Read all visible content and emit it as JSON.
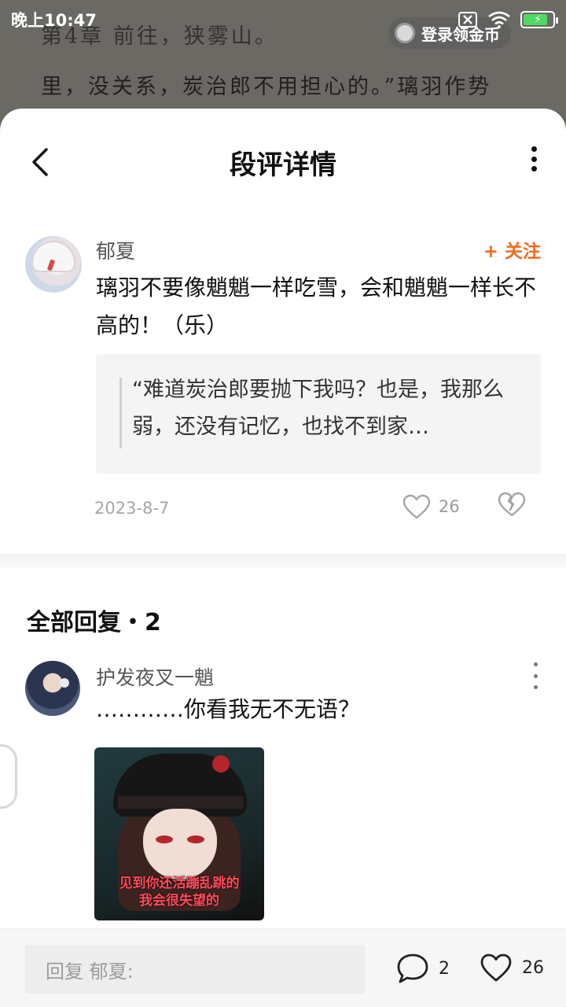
{
  "status_bar": {
    "time": "晚上10:47"
  },
  "reader": {
    "line1": "第4章 前往，狭雾山。",
    "line2": "里，没关系，炭治郎不用担心的。”璃羽作势",
    "login_button": "登录领金币"
  },
  "header": {
    "title": "段评详情"
  },
  "main_comment": {
    "username": "郁夏",
    "follow_label": "+ 关注",
    "text": "璃羽不要像魈魈一样吃雪，会和魈魈一样长不高的！（乐）",
    "quote": "“难道炭治郎要抛下我吗？也是，我那么弱，还没有记忆，也找不到家…",
    "date": "2023-8-7",
    "like_count": "26"
  },
  "replies": {
    "title": "全部回复・2",
    "items": [
      {
        "username": "护发夜叉一魈",
        "text": "…………你看我无不无语？",
        "sticker_caption_line1": "见到你还活蹦乱跳的",
        "sticker_caption_line2": "我会很失望的"
      }
    ]
  },
  "bottom_bar": {
    "reply_placeholder": "回复 郁夏:",
    "comment_count": "2",
    "like_count": "26"
  },
  "colors": {
    "accent_follow": "#f06a1e",
    "battery_green": "#4cd964"
  }
}
